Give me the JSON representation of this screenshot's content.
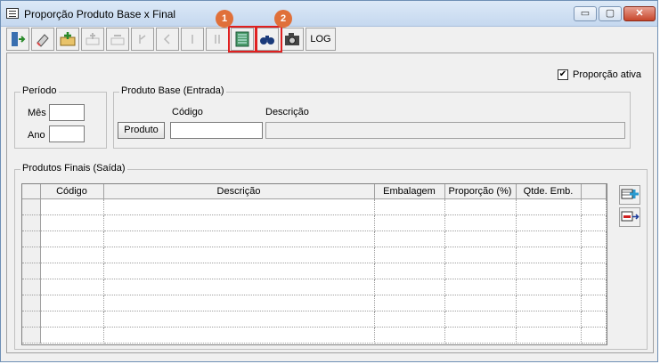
{
  "window": {
    "title": "Proporção Produto Base x Final",
    "minimize_glyph": "▭",
    "maximize_glyph": "▢",
    "close_glyph": "✕"
  },
  "toolbar": {
    "log_label": "LOG",
    "icons": [
      "exit-icon",
      "eraser-icon",
      "add-folder-icon",
      "first-icon",
      "previous-icon",
      "next-icon",
      "last-icon",
      "report-icon",
      "binoculars-icon",
      "camera-icon"
    ]
  },
  "annotations": {
    "badge1": "1",
    "badge2": "2",
    "color": "#e02020",
    "badge_color": "#e0703a"
  },
  "form": {
    "proporcao_ativa_label": "Proporção ativa",
    "proporcao_ativa_checked": "✔",
    "periodo": {
      "legend": "Período",
      "mes_label": "Mês",
      "ano_label": "Ano",
      "mes_value": "",
      "ano_value": ""
    },
    "produto_base": {
      "legend": "Produto Base (Entrada)",
      "codigo_label": "Código",
      "descricao_label": "Descrição",
      "produto_button": "Produto",
      "codigo_value": "",
      "descricao_value": ""
    }
  },
  "produtos_finais": {
    "legend": "Produtos Finais (Saída)",
    "columns": [
      "Código",
      "Descrição",
      "Embalagem",
      "Proporção (%)",
      "Qtde. Emb."
    ]
  }
}
